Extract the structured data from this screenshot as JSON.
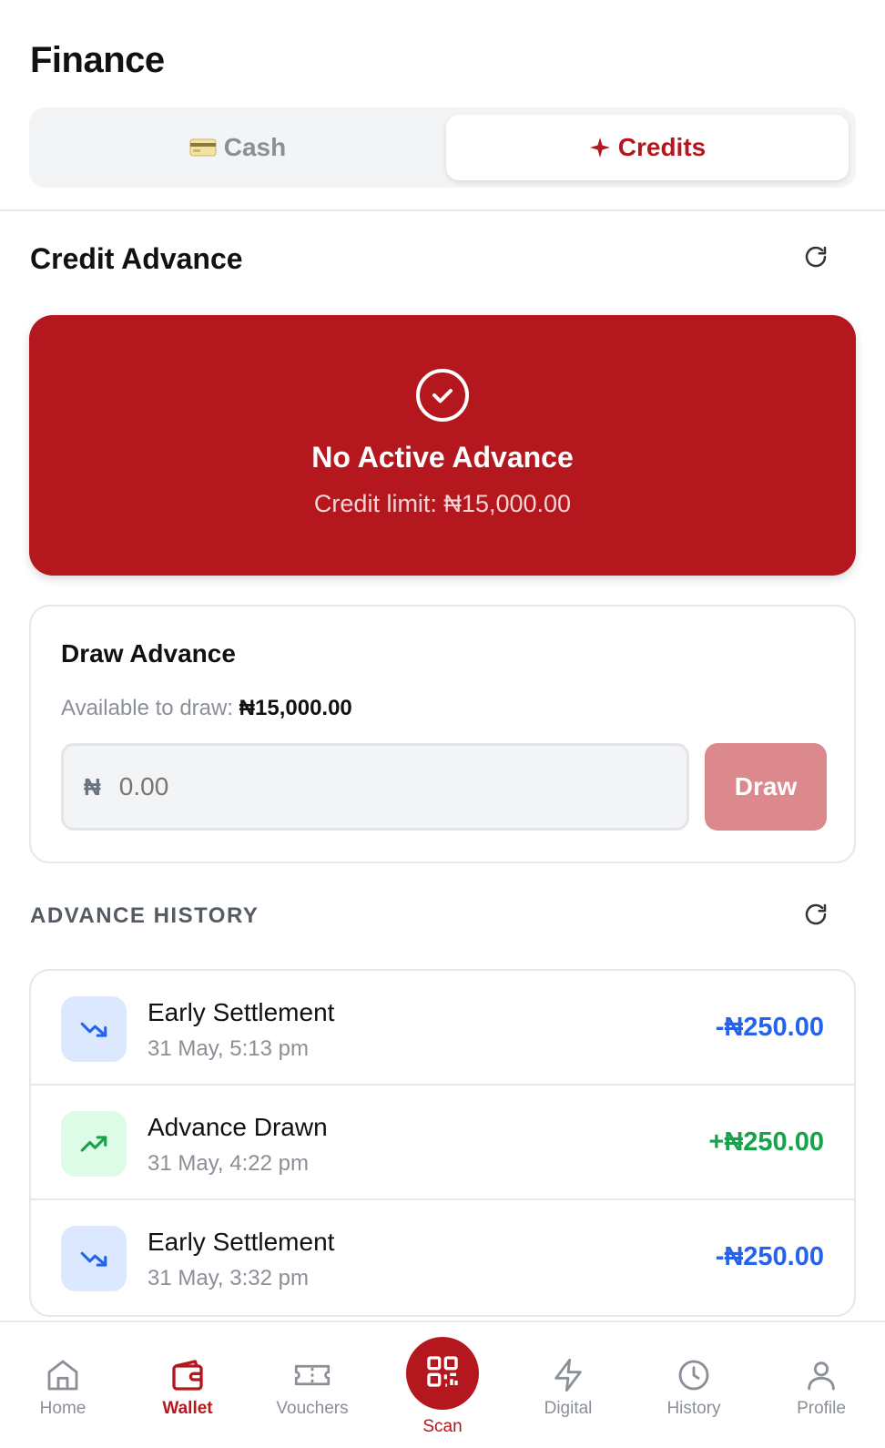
{
  "header": {
    "title": "Finance",
    "tabs": [
      {
        "label": "Cash",
        "icon": "credit-card-icon",
        "active": false
      },
      {
        "label": "Credits",
        "icon": "sparkle-icon",
        "active": true
      }
    ]
  },
  "credit_advance": {
    "title": "Credit Advance",
    "status_title": "No Active Advance",
    "credit_limit_text": "Credit limit: ₦15,000.00"
  },
  "draw": {
    "title": "Draw Advance",
    "available_label": "Available to draw:",
    "available_value": "₦15,000.00",
    "currency_symbol": "₦",
    "amount_placeholder": "0.00",
    "button_label": "Draw"
  },
  "history": {
    "title": "ADVANCE HISTORY",
    "items": [
      {
        "label": "Early Settlement",
        "date": "31 May, 5:13 pm",
        "amount": "-₦250.00",
        "type": "settlement"
      },
      {
        "label": "Advance Drawn",
        "date": "31 May, 4:22 pm",
        "amount": "+₦250.00",
        "type": "drawn"
      },
      {
        "label": "Early Settlement",
        "date": "31 May, 3:32 pm",
        "amount": "-₦250.00",
        "type": "settlement"
      }
    ]
  },
  "nav": {
    "items": [
      {
        "label": "Home",
        "icon": "home-icon"
      },
      {
        "label": "Wallet",
        "icon": "wallet-icon",
        "active": true
      },
      {
        "label": "Vouchers",
        "icon": "ticket-icon"
      },
      {
        "label": "Scan",
        "icon": "qr-code-icon"
      },
      {
        "label": "Digital",
        "icon": "lightning-icon"
      },
      {
        "label": "History",
        "icon": "clock-icon"
      },
      {
        "label": "Profile",
        "icon": "user-icon"
      }
    ]
  },
  "colors": {
    "brand": "#b5171e",
    "brand_light": "#db898c",
    "negative": "#2563eb",
    "positive": "#16a34a"
  }
}
